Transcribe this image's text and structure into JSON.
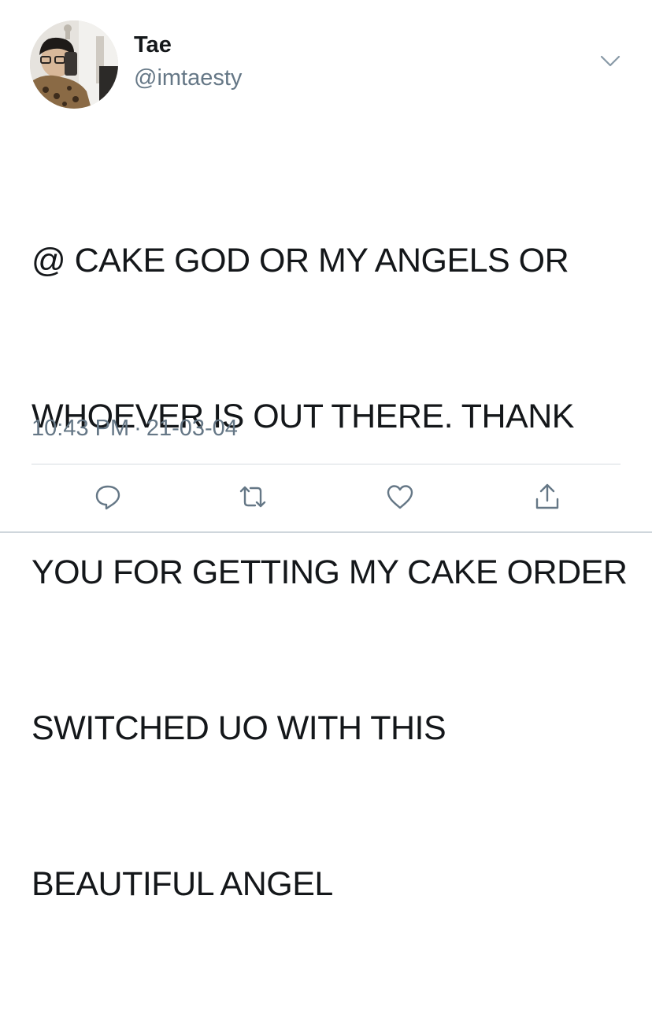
{
  "user": {
    "display_name": "Tae",
    "handle": "@imtaesty",
    "avatar_icon": "avatar-photo"
  },
  "tweet": {
    "text": "@ CAKE GOD OR MY ANGELS OR WHOEVER IS OUT THERE. THANK YOU FOR GETTING MY CAKE ORDER SWITCHED UO WITH THIS BEAUTIFUL ANGEL",
    "lines": [
      "@ CAKE GOD OR MY ANGELS OR",
      "WHOEVER IS OUT THERE. THANK",
      "YOU FOR GETTING MY CAKE ORDER",
      "SWITCHED UO WITH THIS",
      "BEAUTIFUL ANGEL"
    ],
    "time": "10:43 PM",
    "separator": "·",
    "date": "21-03-04"
  },
  "actions": [
    {
      "icon": "reply-icon"
    },
    {
      "icon": "retweet-icon"
    },
    {
      "icon": "like-icon"
    },
    {
      "icon": "share-icon"
    }
  ],
  "colors": {
    "text": "#14171a",
    "secondary": "#657786",
    "icon": "#657786",
    "divider": "#d5dce1"
  }
}
